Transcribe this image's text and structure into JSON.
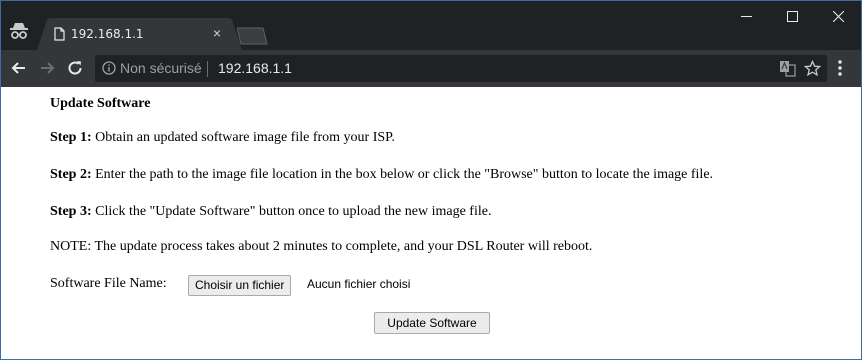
{
  "browser": {
    "tab_title": "192.168.1.1",
    "security_label": "Non sécurisé",
    "url": "192.168.1.1",
    "tab_close_glyph": "×"
  },
  "page": {
    "title": "Update Software",
    "step1_label": "Step 1:",
    "step1_text": " Obtain an updated software image file from your ISP.",
    "step2_label": "Step 2:",
    "step2_text": " Enter the path to the image file location in the box below or click the \"Browse\" button to locate the image file.",
    "step3_label": "Step 3:",
    "step3_text": " Click the \"Update Software\" button once to upload the new image file.",
    "note": "NOTE: The update process takes about 2 minutes to complete, and your DSL Router will reboot.",
    "file_label": "Software File Name:",
    "file_button": "Choisir un fichier",
    "file_status": "Aucun fichier choisi",
    "submit_button": "Update Software"
  },
  "icons": {
    "incognito": "incognito-icon",
    "page": "page-icon",
    "back": "back-arrow-icon",
    "forward": "forward-arrow-icon",
    "reload": "reload-icon",
    "info": "info-icon",
    "translate": "translate-icon",
    "bookmark": "star-icon",
    "menu": "menu-icon"
  },
  "colors": {
    "tabstrip": "#202124",
    "toolbar": "#35363a",
    "window_border": "#3a6ea5"
  }
}
